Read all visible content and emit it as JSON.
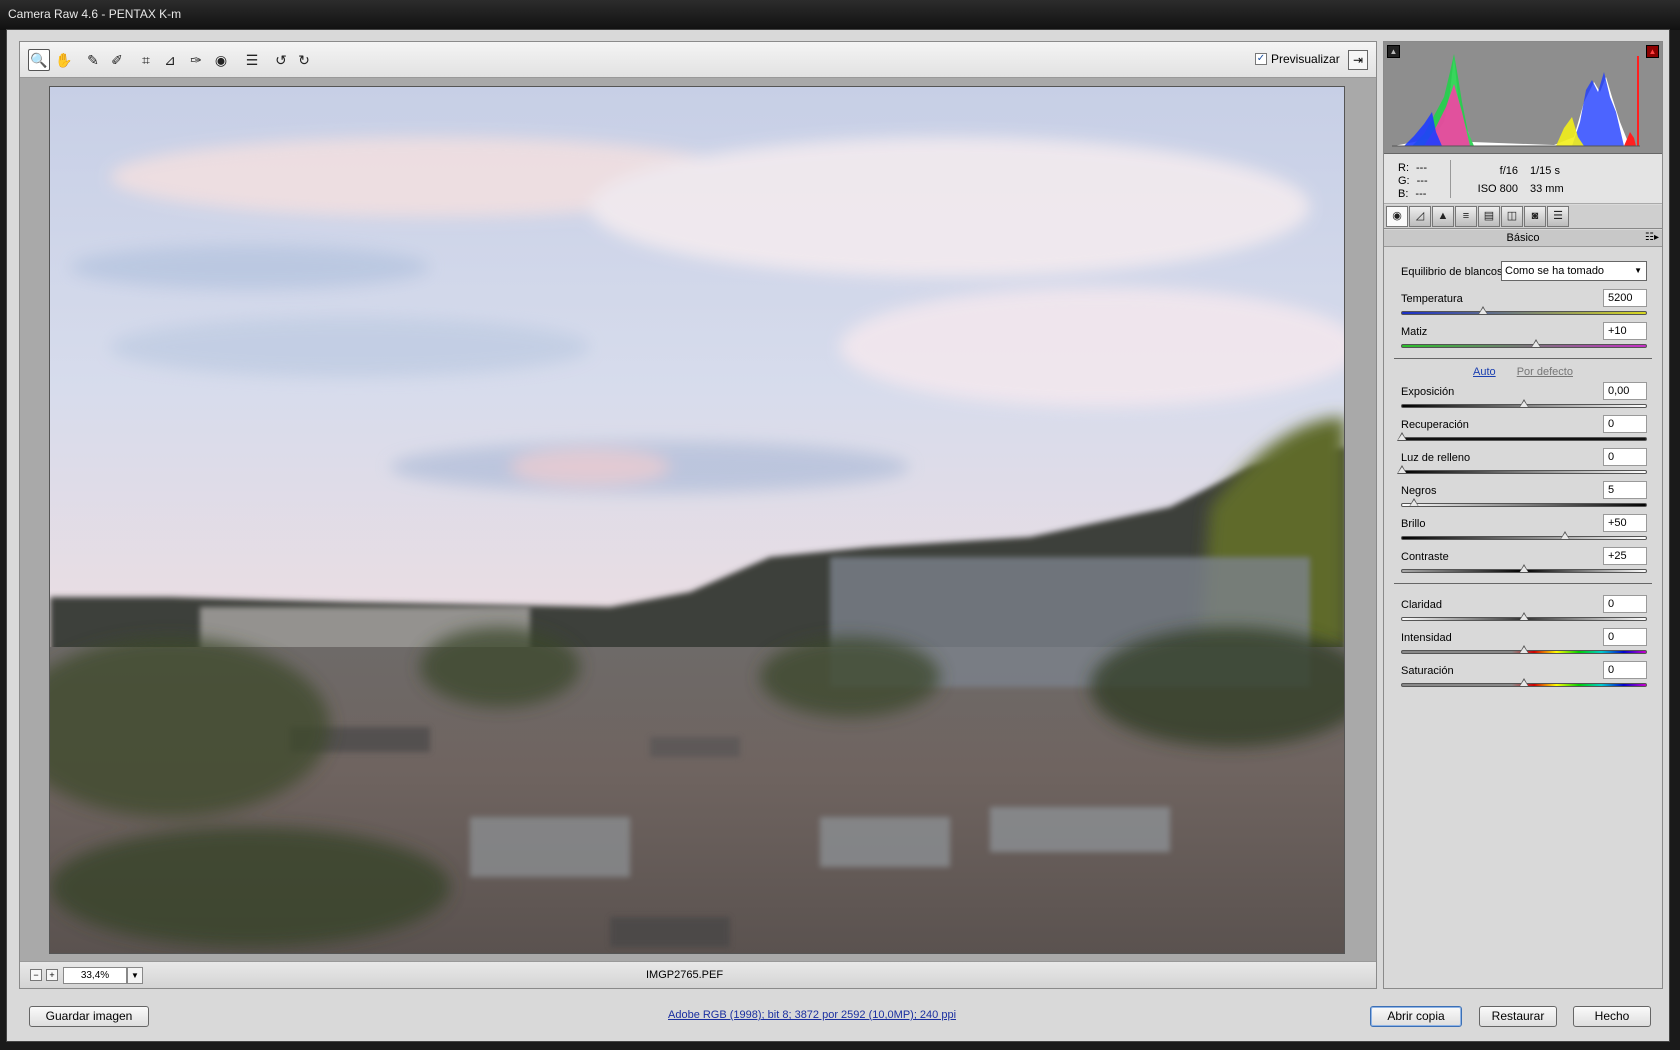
{
  "window": {
    "title": "Camera Raw 4.6 -  PENTAX K-m"
  },
  "toolbar": {
    "tools": [
      {
        "name": "zoom-tool",
        "glyph": "🔍"
      },
      {
        "name": "hand-tool",
        "glyph": "✋"
      },
      {
        "name": "white-balance-tool",
        "glyph": "✎"
      },
      {
        "name": "color-sampler-tool",
        "glyph": "✐"
      },
      {
        "name": "crop-tool",
        "glyph": "⌗"
      },
      {
        "name": "straighten-tool",
        "glyph": "⊿"
      },
      {
        "name": "retouch-tool",
        "glyph": "✑"
      },
      {
        "name": "red-eye-tool",
        "glyph": "◉"
      },
      {
        "name": "preferences-tool",
        "glyph": "☰"
      },
      {
        "name": "rotate-left-tool",
        "glyph": "↺"
      },
      {
        "name": "rotate-right-tool",
        "glyph": "↻"
      }
    ],
    "preview_label": "Previsualizar",
    "preview_checked": "✓"
  },
  "status": {
    "zoom_value": "33,4%",
    "filename": "IMGP2765.PEF",
    "zoom_out": "−",
    "zoom_in": "+",
    "dropdown": "▼"
  },
  "histogram": {
    "shadow_clip": "▲",
    "highlight_clip": "▲"
  },
  "readout": {
    "r_label": "R:",
    "r_value": "---",
    "g_label": "G:",
    "g_value": "---",
    "b_label": "B:",
    "b_value": "---",
    "aperture": "f/16",
    "shutter": "1/15 s",
    "iso": "ISO 800",
    "focal": "33 mm"
  },
  "panel": {
    "title": "Básico",
    "menu_icon": "☷▸",
    "tabs": [
      "◉",
      "◿",
      "▲",
      "≡",
      "▤",
      "◫",
      "◙",
      "☰"
    ],
    "white_balance_label": "Equilibrio de blancos:",
    "white_balance_value": "Como se ha tomado",
    "auto_label": "Auto",
    "default_label": "Por defecto",
    "adjustments": [
      {
        "key": "temperatura",
        "label": "Temperatura",
        "value": "5200",
        "pos": 0.33
      },
      {
        "key": "matiz",
        "label": "Matiz",
        "value": "+10",
        "pos": 0.55
      },
      {
        "key": "exposicion",
        "label": "Exposición",
        "value": "0,00",
        "pos": 0.5
      },
      {
        "key": "recuperacion",
        "label": "Recuperación",
        "value": "0",
        "pos": 0.0
      },
      {
        "key": "luz-de-relleno",
        "label": "Luz de relleno",
        "value": "0",
        "pos": 0.0
      },
      {
        "key": "negros",
        "label": "Negros",
        "value": "5",
        "pos": 0.05
      },
      {
        "key": "brillo",
        "label": "Brillo",
        "value": "+50",
        "pos": 0.67
      },
      {
        "key": "contraste",
        "label": "Contraste",
        "value": "+25",
        "pos": 0.5
      },
      {
        "key": "claridad",
        "label": "Claridad",
        "value": "0",
        "pos": 0.5
      },
      {
        "key": "intensidad",
        "label": "Intensidad",
        "value": "0",
        "pos": 0.5
      },
      {
        "key": "saturacion",
        "label": "Saturación",
        "value": "0",
        "pos": 0.5
      }
    ]
  },
  "bottom": {
    "save_label": "Guardar imagen",
    "workflow_text": "Adobe RGB (1998); bit 8; 3872 por 2592 (10,0MP); 240 ppi",
    "open_copy_label": "Abrir copia",
    "reset_label": "Restaurar",
    "done_label": "Hecho"
  }
}
